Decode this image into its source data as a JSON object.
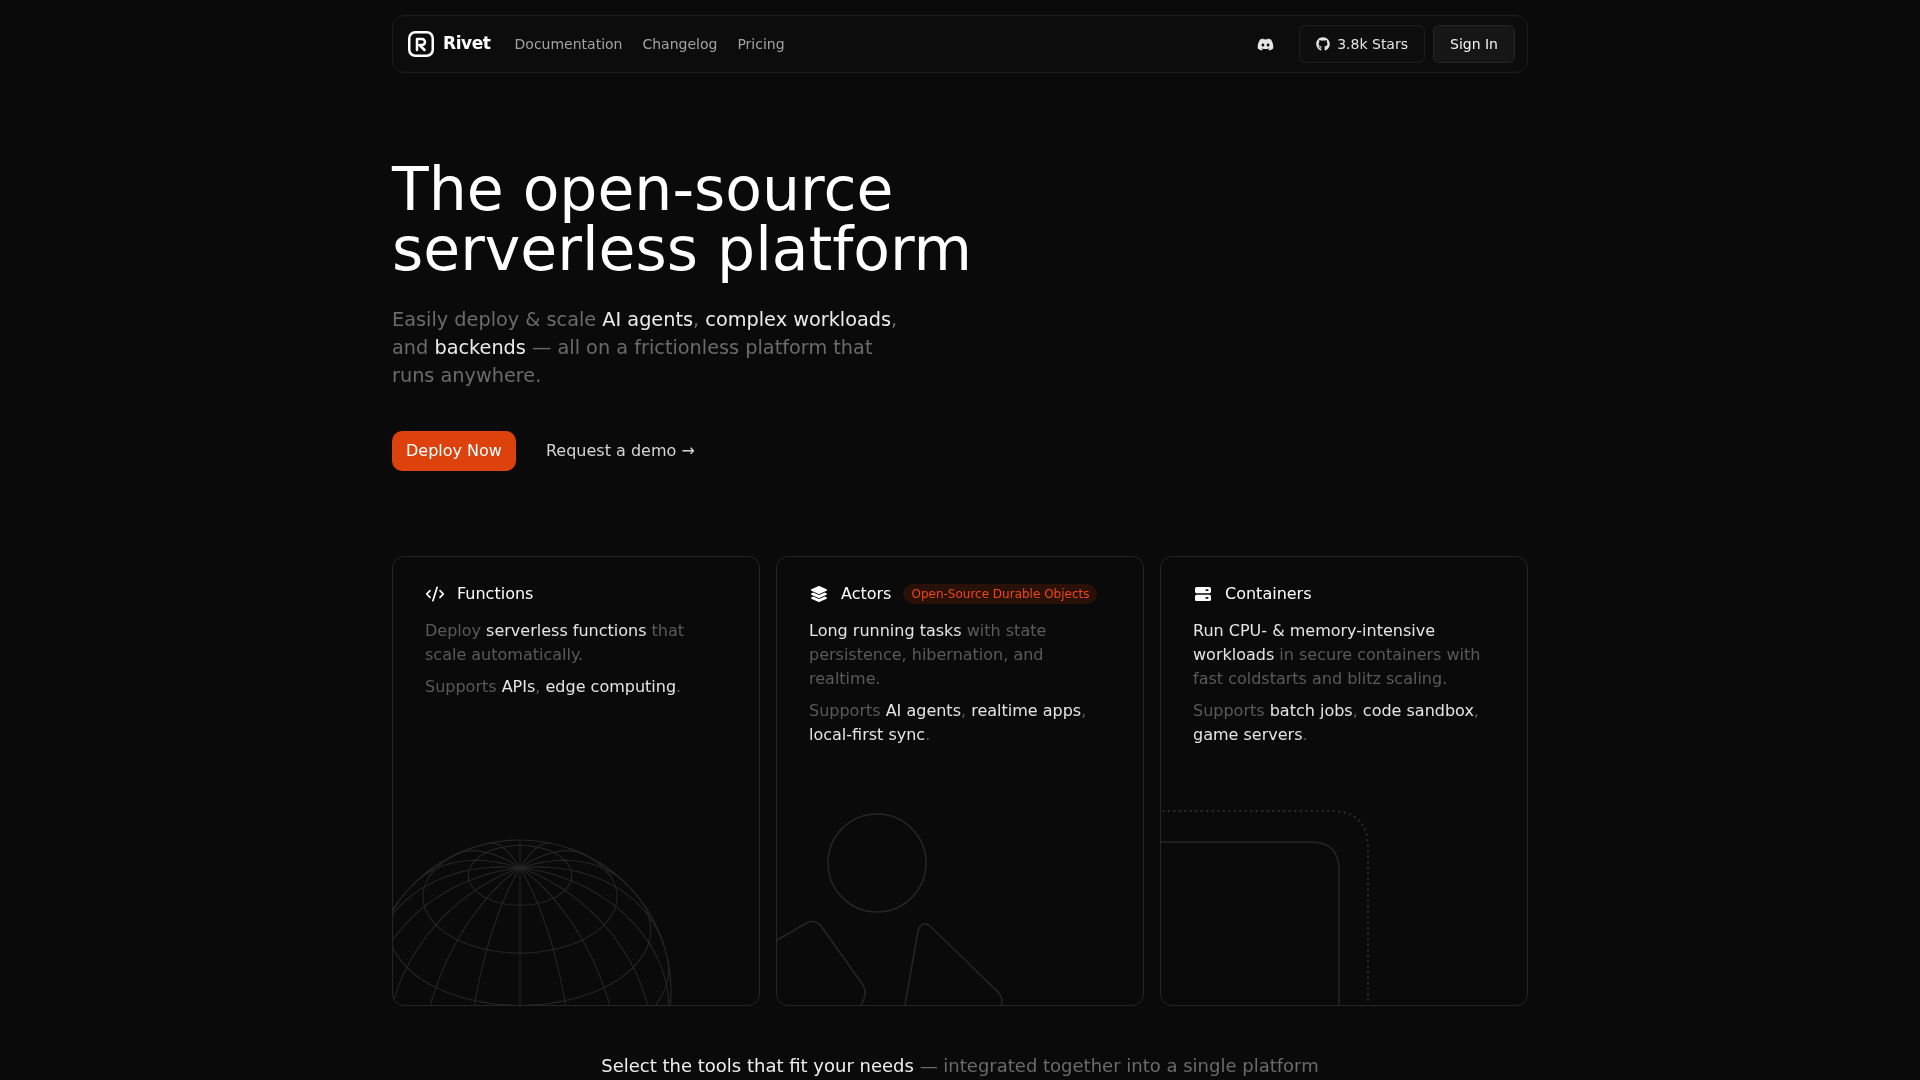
{
  "nav": {
    "brand": "Rivet",
    "links": [
      "Documentation",
      "Changelog",
      "Pricing"
    ],
    "stars_button": "3.8k Stars",
    "sign_in_button": "Sign In"
  },
  "hero": {
    "title": "The open-source serverless platform",
    "subtitle": [
      {
        "text": "Easily deploy & scale ",
        "highlight": false
      },
      {
        "text": "AI agents",
        "highlight": true
      },
      {
        "text": ", ",
        "highlight": false
      },
      {
        "text": "complex workloads",
        "highlight": true
      },
      {
        "text": ", and ",
        "highlight": false
      },
      {
        "text": "backends",
        "highlight": true
      },
      {
        "text": " — all on a frictionless platform that runs anywhere.",
        "highlight": false
      }
    ],
    "primary_button": "Deploy Now",
    "secondary_link": "Request a demo →"
  },
  "cards": [
    {
      "kind": "functions",
      "title": "Functions",
      "description": [
        {
          "text": "Deploy ",
          "highlight": false
        },
        {
          "text": "serverless functions",
          "highlight": true
        },
        {
          "text": " that scale automatically.",
          "highlight": false
        }
      ],
      "supports": [
        {
          "text": "Supports ",
          "highlight": false
        },
        {
          "text": "APIs",
          "highlight": true
        },
        {
          "text": ", ",
          "highlight": false
        },
        {
          "text": "edge computing",
          "highlight": true
        },
        {
          "text": ".",
          "highlight": false
        }
      ]
    },
    {
      "kind": "actors",
      "title": "Actors",
      "badge": "Open-Source Durable Objects",
      "description": [
        {
          "text": "Long running tasks",
          "highlight": true
        },
        {
          "text": " with state persistence, hibernation, and realtime.",
          "highlight": false
        }
      ],
      "supports": [
        {
          "text": "Supports ",
          "highlight": false
        },
        {
          "text": "AI agents",
          "highlight": true
        },
        {
          "text": ", ",
          "highlight": false
        },
        {
          "text": "realtime apps",
          "highlight": true
        },
        {
          "text": ", ",
          "highlight": false
        },
        {
          "text": "local-first sync",
          "highlight": true
        },
        {
          "text": ".",
          "highlight": false
        }
      ]
    },
    {
      "kind": "containers",
      "title": "Containers",
      "description": [
        {
          "text": "Run CPU- & memory-intensive workloads",
          "highlight": true
        },
        {
          "text": " in secure containers with fast coldstarts and blitz scaling.",
          "highlight": false
        }
      ],
      "supports": [
        {
          "text": "Supports ",
          "highlight": false
        },
        {
          "text": "batch jobs",
          "highlight": true
        },
        {
          "text": ", ",
          "highlight": false
        },
        {
          "text": "code sandbox",
          "highlight": true
        },
        {
          "text": ", ",
          "highlight": false
        },
        {
          "text": "game servers",
          "highlight": true
        },
        {
          "text": ".",
          "highlight": false
        }
      ]
    }
  ],
  "section_heading": [
    {
      "text": "Select the tools that fit your needs",
      "highlight": true
    },
    {
      "text": " — integrated together into a single platform",
      "highlight": false
    }
  ]
}
